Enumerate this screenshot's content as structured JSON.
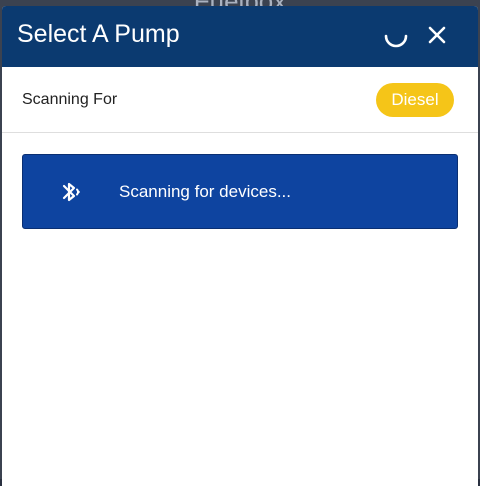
{
  "backdrop": {
    "title": "Fuelbox"
  },
  "modal": {
    "title": "Select A Pump",
    "header_color": "#0b3a70",
    "loading_icon": "spinner-icon",
    "close_icon": "close-icon"
  },
  "scanning": {
    "label": "Scanning For",
    "fuel_type": "Diesel",
    "badge_color": "#f5c518"
  },
  "status_card": {
    "icon": "bluetooth-searching-icon",
    "message": "Scanning for devices...",
    "card_color": "#0e44a0"
  }
}
